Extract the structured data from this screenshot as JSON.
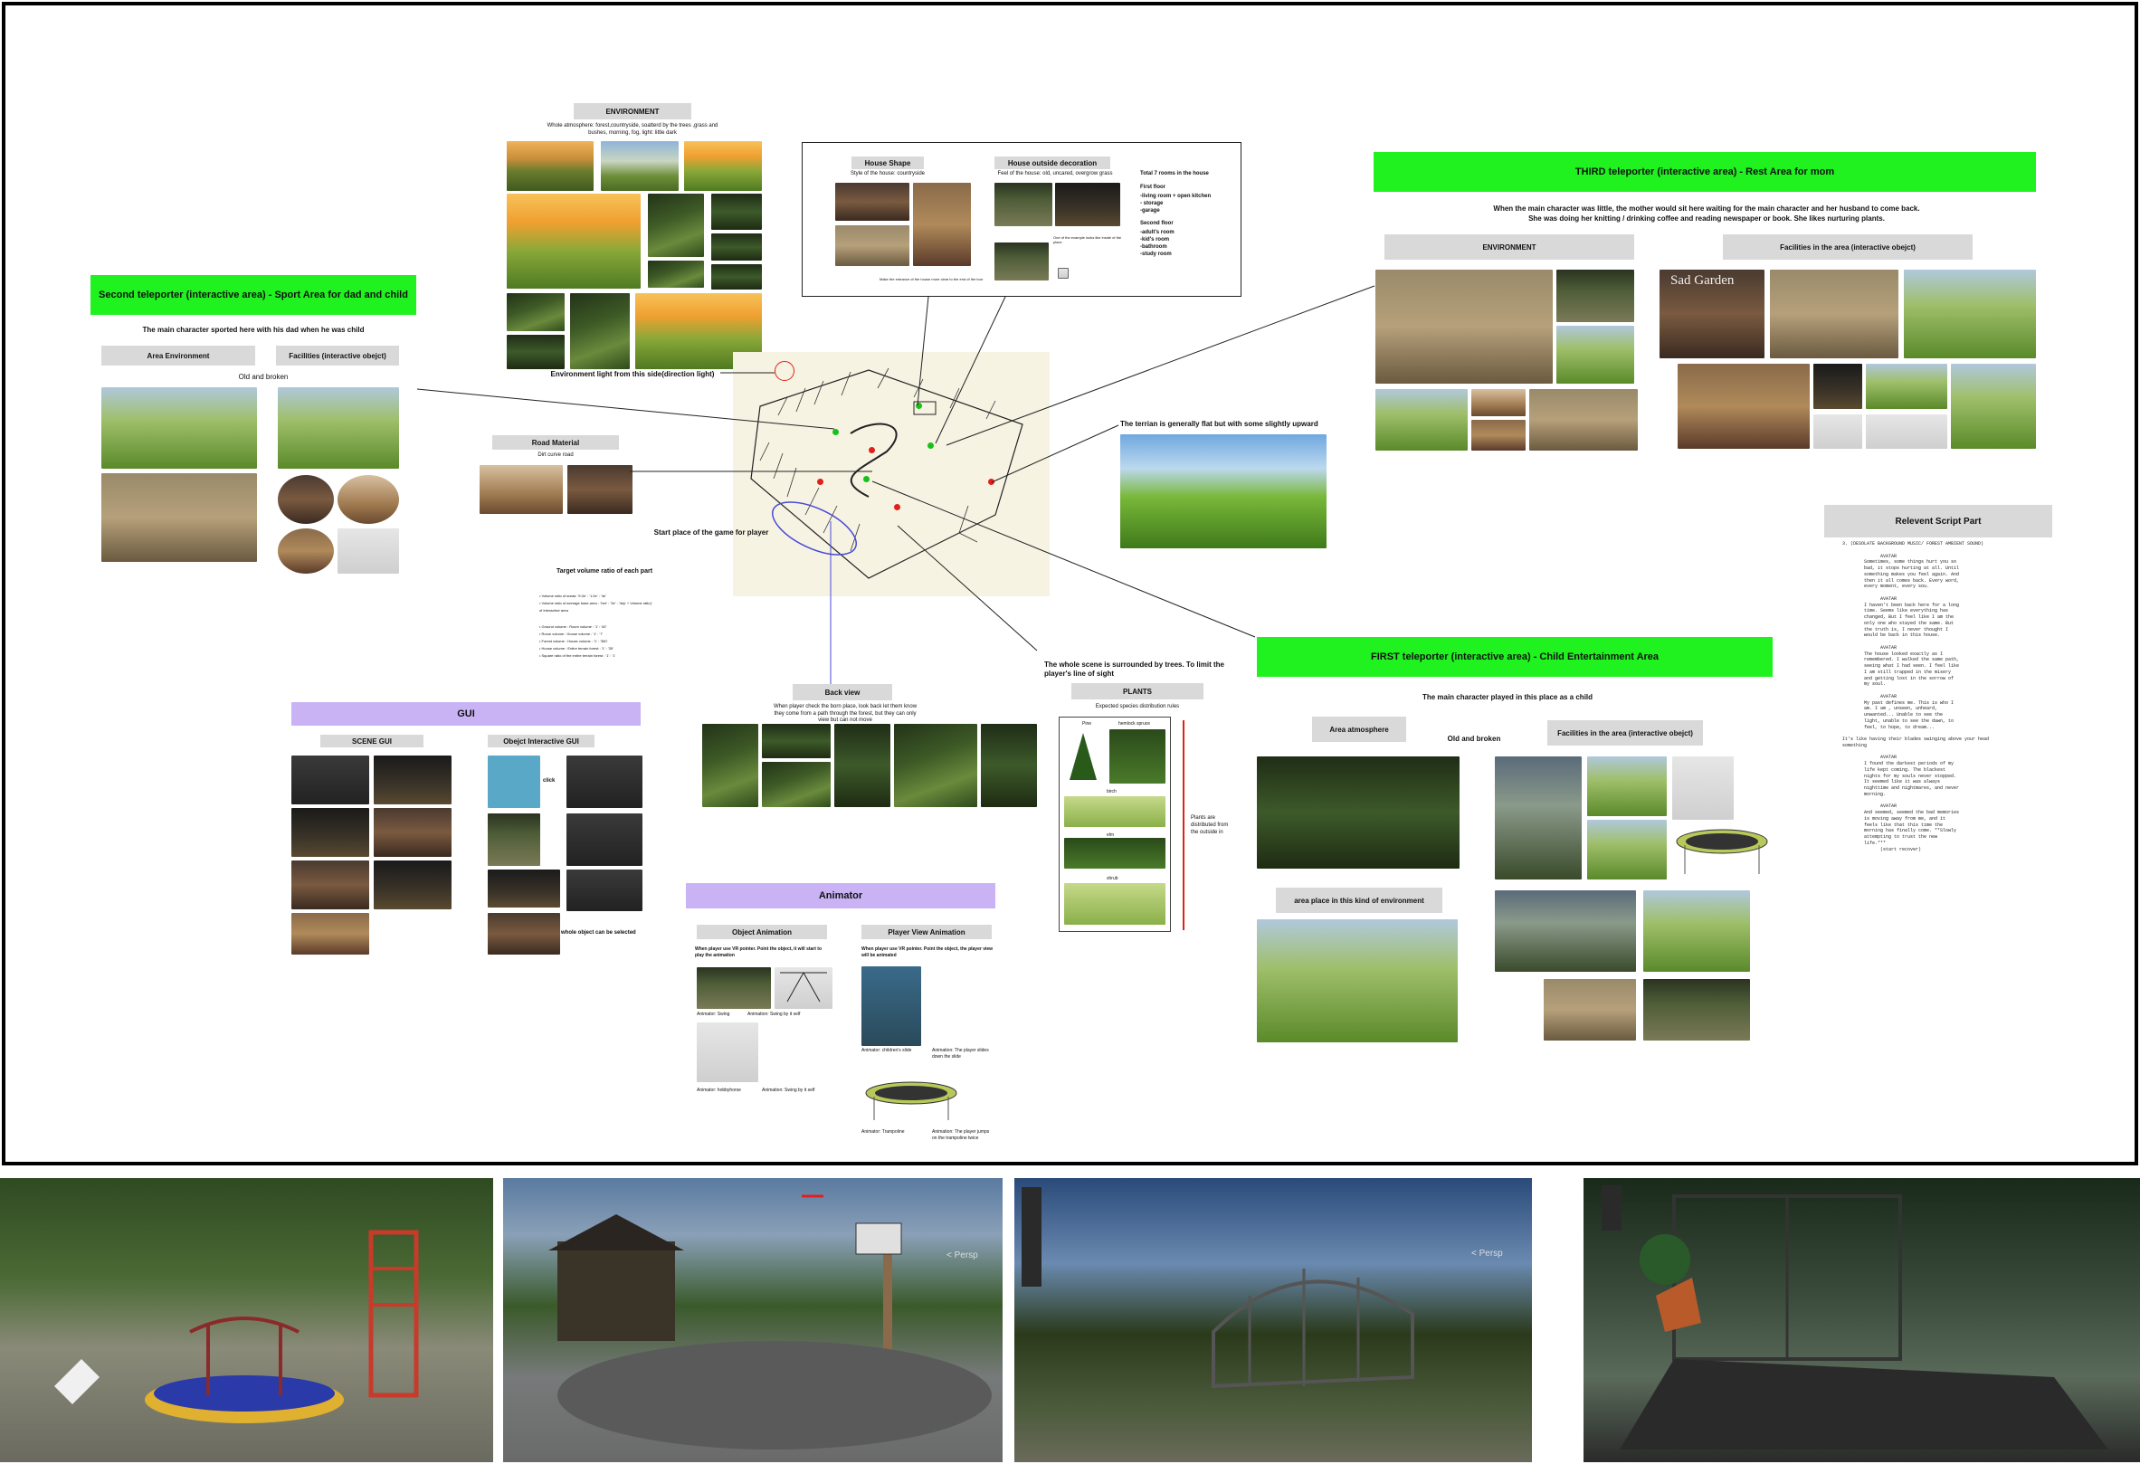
{
  "environment": {
    "title": "ENVIRONMENT",
    "desc": "Whole atmosphere: forest,countryside, soatterd by the trees ,grass and bushes, morning, fog, light: little dark",
    "light_note": "Environment light from this side(direction light)"
  },
  "house": {
    "shape_title": "House Shape",
    "shape_desc": "Style of the house: countryside",
    "decor_title": "House outside decoration",
    "decor_desc": "Feel of the house: old, uncared, overgrow grass",
    "decor_note": "One of the example looks like inside of the place",
    "bottom_note": "Make the entrance of the house more clear to the end of the tour",
    "rooms_title": "Total 7 rooms in the house",
    "first_floor": "First floor",
    "first_items": [
      "-living room + open kitchen",
      "- storage",
      "-garage"
    ],
    "second_floor": "Second floor",
    "second_items": [
      "-adult's room",
      "-kid's room",
      "-bathroom",
      "-study room"
    ]
  },
  "second": {
    "title": "Second teleporter (interactive area) - Sport Area for dad and child",
    "desc": "The main character sported here with his dad when he was child",
    "env_label": "Area Environment",
    "fac_label": "Facilities  (interactive obejct)",
    "old_label": "Old and broken"
  },
  "road": {
    "title": "Road Material",
    "desc": "Dirt curve road"
  },
  "start_place": "Start place of the game for player",
  "target_volume": {
    "title": "Target volume ratio of each part",
    "lines": [
      "• Volume ratio of areas: '9.0e' : '1.0e' : '4e'",
      "• Volume ratio of average base area : '1ee' : '3e' : '4e(r + Volume ratio)'",
      "  of interactive area",
      "",
      "• Ground volume : Room volume : '1' : '40'",
      "• Room volume : House volume : '1' : '7'",
      "• Forest volume : House volume : '1' : '350'",
      "• House volume : Entire terrain forest : '1' : '35'",
      "• Square ratio of the entire terrain forest : '1' : '1'"
    ]
  },
  "terrain_note": "The terrian is generally flat but with some slightly upward",
  "surrounded_note": "The whole scene is surrounded by trees. To limit the player's line of sight",
  "back_view": {
    "title": "Back view",
    "desc": "When player check the born place, look back let them know they come from a path through the forest, but they can only view but can not move"
  },
  "plants": {
    "title": "PLANTS",
    "desc": "Expected species distribution rules",
    "names": [
      "Pine",
      "hemlock spruce",
      "birch",
      "elm",
      "shrub"
    ],
    "side_note": "Plants are distributed from the outside in"
  },
  "gui": {
    "title": "GUI",
    "scene_label": "SCENE GUI",
    "object_label": "Obejct Interactive GUI",
    "click": "click",
    "selected": "whole object can be selected"
  },
  "animator": {
    "title": "Animator",
    "obj_label": "Object Animation",
    "obj_desc": "When player use VR pointer. Point the object, it will start to play the animation",
    "view_label": "Player View Animation",
    "view_desc": "When player use VR pointer. Point the object, the player view will be animated",
    "caps": [
      "Animator: Swing",
      "Animation: Swing by it self",
      "Animator: hobbyhorse",
      "Animation: Swing by it self",
      "Animator: children's slide",
      "Animation: The player slides down the slide",
      "Animator: Trampoline",
      "Animation: The player jumps on the trampoline twice"
    ]
  },
  "third": {
    "title": "THIRD teleporter (interactive area) - Rest Area for mom",
    "desc1": "When the main character was little, the mother would sit here waiting for the main character and her husband to come back.",
    "desc2": "She was doing her knitting / drinking coffee and reading newspaper or book.  She likes nurturing plants.",
    "env_label": "ENVIRONMENT",
    "fac_label": "Facilities in the area (interactive obejct)",
    "sad_garden": "Sad Garden"
  },
  "script": {
    "title": "Relevent Script Part",
    "text": "3. (DESOLATE BACKGROUND MUSIC/ FOREST AMBIENT SOUND)\n\n              AVATAR\n        Sometimes, some things hurt you so\n        bad, it stops hurting at all. Until\n        something makes you feel again. And\n        then it all comes back. Every word,\n        every moment, every sou.\n\n              AVATAR\n        I haven't been back here for a long\n        time. Seems like everything has\n        changed, But I feel like I am the\n        only one who stayed the same. But\n        the truth is, I never thought I\n        would be back in this house.\n\n              AVATAR\n        The house looked exactly as I\n        remembered. I walked the same path,\n        seeing what I had seen. I feel like\n        I am still trapped in the misery\n        and getting lost in the sorrow of\n        my soul.\n\n              AVATAR\n        My past defines me. This is who I\n        am. I am , unseen, unheard,\n        unwanted... Unable to see the\n        light, unable to see the dawn, to\n        feel, to hope, to dream...\n\nIt's like having their blades swinging above your head\nsomething\n\n              AVATAR\n        I found the darkest periods of my\n        life kept coming. The blackest\n        nights for my souls never stopped.\n        It seemed like it was always\n        nighttime and nightmares, and never\n        morning.\n\n              AVATAR\n        And seemed, seemed the bad memories\n        is moving away from me, and it\n        feels like that this time the\n        morning has finally come. **Slowly\n        attempting to trust the new\n        life.***\n              (start recover)"
  },
  "first": {
    "title": "FIRST teleporter (interactive area) - Child Entertainment Area",
    "desc": "The main character played in this place as a child",
    "atmo_label": "Area atmosphere",
    "old_label": "Old and broken",
    "fac_label": "Facilities in the area (interactive obejct)",
    "place_label": "area place in this kind of environment"
  },
  "screens": {
    "persp": "< Persp"
  },
  "colors": {
    "green_bar": "#1ff21f",
    "purple_bar": "#c9b3f5",
    "gray_label": "#d9d9d9",
    "marker_red": "#e0201a",
    "marker_green": "#17c117"
  }
}
